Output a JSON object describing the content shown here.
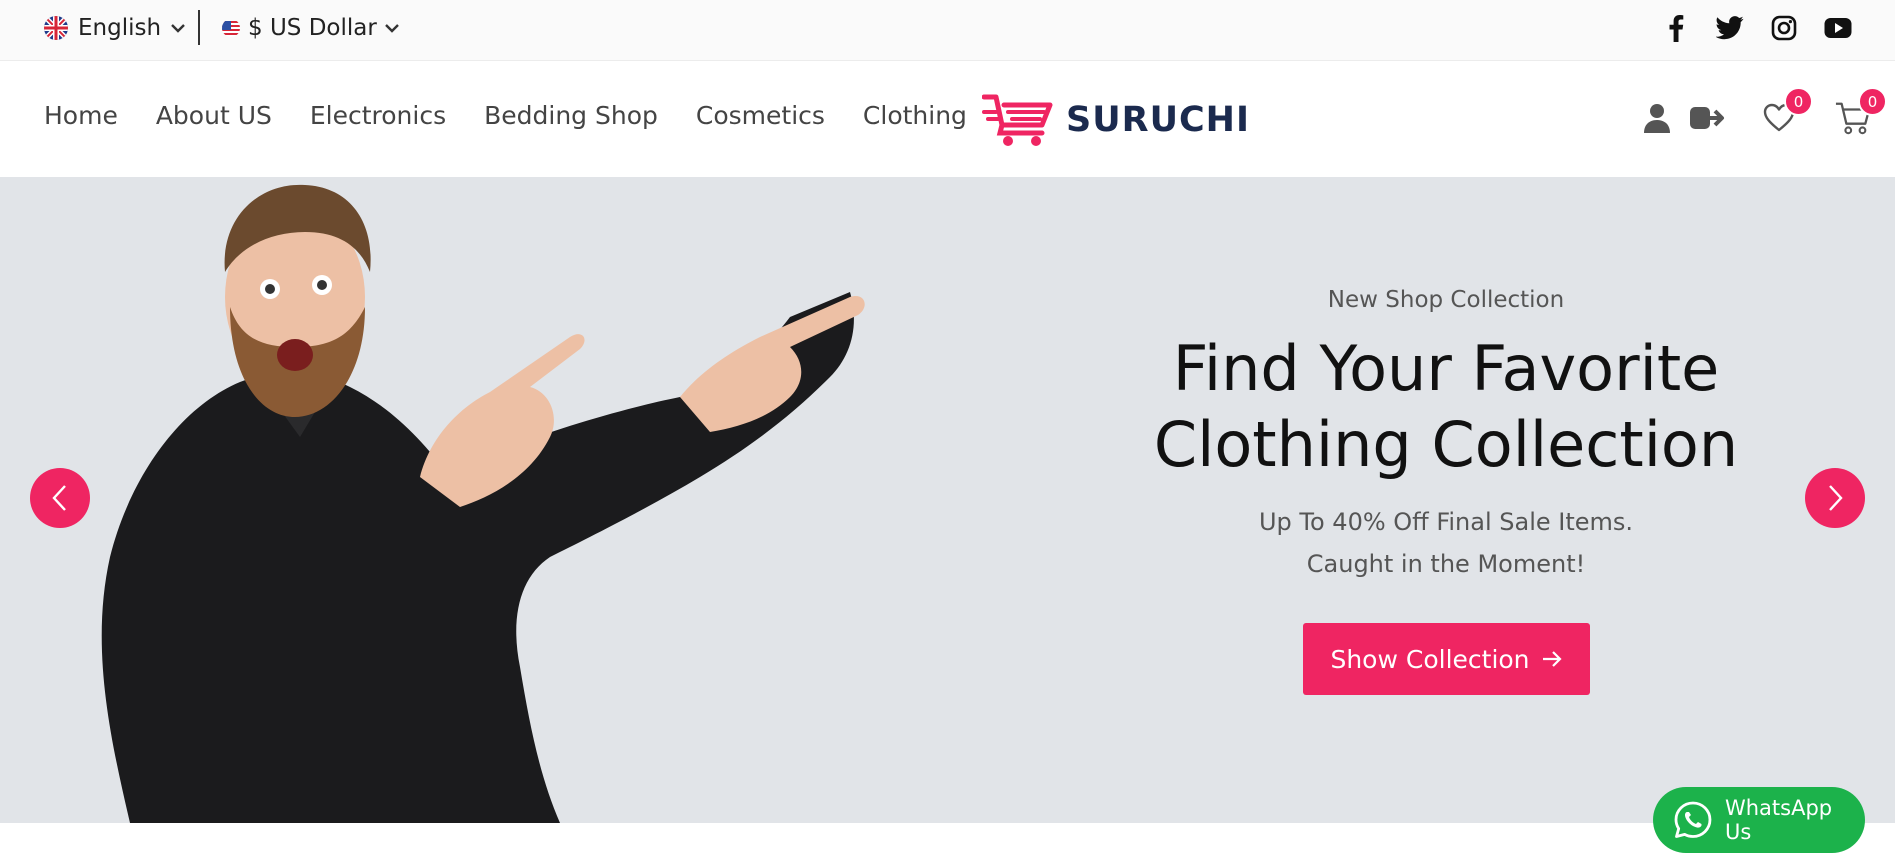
{
  "topbar": {
    "language": "English",
    "currency": "$ US Dollar",
    "social": [
      "facebook-icon",
      "twitter-icon",
      "instagram-icon",
      "youtube-icon"
    ]
  },
  "header": {
    "nav": [
      "Home",
      "About US",
      "Electronics",
      "Bedding Shop",
      "Cosmetics",
      "Clothing"
    ],
    "logo_text": "SURUCHI",
    "wishlist_count": "0",
    "cart_count": "0"
  },
  "hero": {
    "eyebrow": "New Shop Collection",
    "headline_line1": "Find Your Favorite",
    "headline_line2": "Clothing Collection",
    "sub_line1": "Up To 40% Off Final Sale Items.",
    "sub_line2": "Caught in the Moment!",
    "cta_label": "Show Collection"
  },
  "whatsapp": {
    "label": "WhatsApp Us"
  },
  "colors": {
    "accent": "#ef2562",
    "brand_dark": "#1b2a4e",
    "hero_bg": "#e1e4e8",
    "whatsapp": "#1cb24b"
  }
}
